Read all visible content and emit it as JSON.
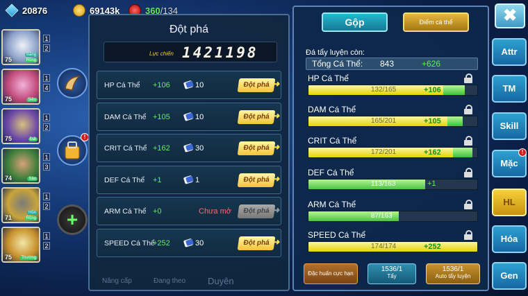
{
  "resources": {
    "gems": "20876",
    "gold": "69143k",
    "energy_current": "360",
    "energy_max": "/134"
  },
  "pets": [
    {
      "level": "75",
      "tag1": "Băng",
      "tag2": "Rồng",
      "num1": "1",
      "num2": "2",
      "color1": "#eef2f8",
      "color2": "#8aa0c8"
    },
    {
      "level": "75",
      "tag1": "Siêu",
      "tag2": "",
      "num1": "1",
      "num2": "4",
      "color1": "#f2b2d8",
      "color2": "#c04a7a"
    },
    {
      "level": "75",
      "tag1": "Đất",
      "tag2": "",
      "num1": "1",
      "num2": "2",
      "color1": "#d7c07e",
      "color2": "#6e4aa8"
    },
    {
      "level": "74",
      "tag1": "Sâu",
      "tag2": "",
      "num1": "1",
      "num2": "3",
      "color1": "#d8a078",
      "color2": "#3e7f3a"
    },
    {
      "level": "71",
      "tag1": "Hỏn",
      "tag2": "Rồng",
      "num1": "1",
      "num2": "2",
      "color1": "#7a7a7a",
      "color2": "#c9a53a"
    },
    {
      "level": "75",
      "tag1": "Thường",
      "tag2": "",
      "num1": "1",
      "num2": "2",
      "color1": "#f2e6a6",
      "color2": "#c78f2a"
    }
  ],
  "breakthrough": {
    "title": "Đột phá",
    "power_label": "Lực chiến",
    "power_value": "1421198",
    "rows": [
      {
        "name": "HP Cá Thể",
        "bonus": "+106",
        "cost": "10",
        "button": "Đột phá",
        "enabled": true
      },
      {
        "name": "DAM Cá Thể",
        "bonus": "+105",
        "cost": "10",
        "button": "Đột phá",
        "enabled": true
      },
      {
        "name": "CRIT Cá Thể",
        "bonus": "+162",
        "cost": "30",
        "button": "Đột phá",
        "enabled": true
      },
      {
        "name": "DEF Cá Thể",
        "bonus": "+1",
        "cost": "1",
        "button": "Đột phá",
        "enabled": true
      },
      {
        "name": "ARM Cá Thể",
        "bonus": "+0",
        "cost": "Chưa mở",
        "button": "Đột phá",
        "enabled": false
      },
      {
        "name": "SPEED Cá Thể",
        "bonus": "+252",
        "cost": "30",
        "button": "Đột phá",
        "enabled": true
      }
    ],
    "bottom_tabs": [
      "Nâng cấp",
      "Đang theo",
      "Duyên"
    ]
  },
  "training": {
    "tab_merge": "Gộp",
    "tab_points": "Điểm cá thể",
    "remaining_label": "Đá tẩy luyện còn:",
    "total_label": "Tổng Cá Thể:",
    "total_value": "843",
    "total_bonus": "+626",
    "stats": [
      {
        "name": "HP Cá Thể",
        "current": 132,
        "max": 165,
        "text": "132/165",
        "gain": "+106",
        "gain_fraction": 0.64
      },
      {
        "name": "DAM Cá Thể",
        "current": 165,
        "max": 201,
        "text": "165/201",
        "gain": "+105",
        "gain_fraction": 0.52
      },
      {
        "name": "CRIT Cá Thể",
        "current": 172,
        "max": 201,
        "text": "172/201",
        "gain": "+162",
        "gain_fraction": 0.81
      },
      {
        "name": "DEF Cá Thể",
        "current": 113,
        "max": 163,
        "text": "113/163",
        "gain": "+1",
        "gain_fraction": 0.0
      },
      {
        "name": "ARM Cá Thể",
        "current": 87,
        "max": 163,
        "text": "87/163",
        "gain": "",
        "gain_fraction": 0.0
      },
      {
        "name": "SPEED Cá Thể",
        "current": 174,
        "max": 174,
        "text": "174/174",
        "gain": "+252",
        "gain_fraction": 1.0
      }
    ],
    "buttons": {
      "ultimate": "Đặc huấn cực hạn",
      "wash_count": "1536/1",
      "wash_label": "Tẩy",
      "auto_count": "1536/1",
      "auto_label": "Auto tẩy luyện"
    }
  },
  "side_menu": {
    "close": "✖",
    "items": [
      "Attr",
      "TM",
      "Skill",
      "Mặc",
      "HL",
      "Hóa",
      "Gen"
    ],
    "active": "HL",
    "alert": "!"
  },
  "colors": {
    "accent_green": "#5ef05a",
    "button_gold": "#f2c338",
    "panel_border": "#5e85b5"
  }
}
